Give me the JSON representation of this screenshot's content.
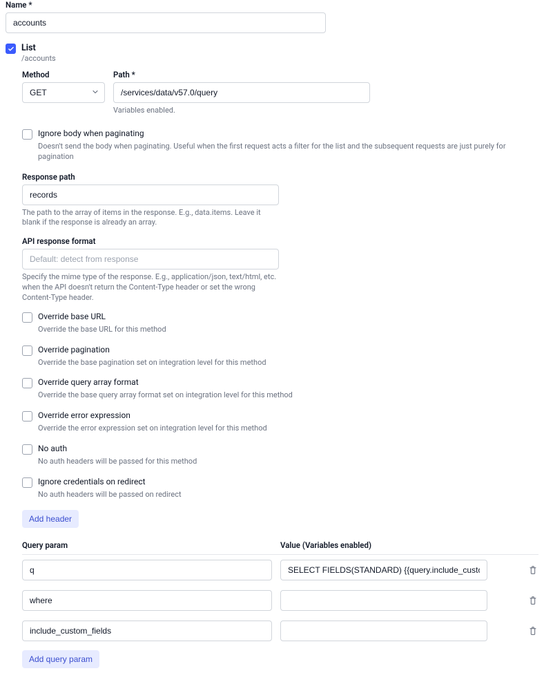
{
  "name": {
    "label": "Name *",
    "value": "accounts"
  },
  "listSection": {
    "checked": true,
    "title": "List",
    "subpath": "/accounts",
    "method": {
      "label": "Method",
      "value": "GET"
    },
    "path": {
      "label": "Path *",
      "value": "/services/data/v57.0/query",
      "hint": "Variables enabled."
    },
    "ignoreBody": {
      "label": "Ignore body when paginating",
      "hint": "Doesn't send the body when paginating. Useful when the first request acts a filter for the list and the subsequent requests are just purely for pagination"
    },
    "responsePath": {
      "label": "Response path",
      "value": "records",
      "hint": "The path to the array of items in the response. E.g., data.items. Leave it blank if the response is already an array."
    },
    "apiFormat": {
      "label": "API response format",
      "placeholder": "Default: detect from response",
      "hint": "Specify the mime type of the response. E.g., application/json, text/html, etc. when the API doesn't return the Content-Type header or set the wrong Content-Type header."
    },
    "options": [
      {
        "label": "Override base URL",
        "hint": "Override the base URL for this method"
      },
      {
        "label": "Override pagination",
        "hint": "Override the base pagination set on integration level for this method"
      },
      {
        "label": "Override query array format",
        "hint": "Override the base query array format set on integration level for this method"
      },
      {
        "label": "Override error expression",
        "hint": "Override the error expression set on integration level for this method"
      },
      {
        "label": "No auth",
        "hint": "No auth headers will be passed for this method"
      },
      {
        "label": "Ignore credentials on redirect",
        "hint": "No auth headers will be passed on redirect"
      }
    ],
    "addHeaderLabel": "Add header",
    "queryTable": {
      "headers": {
        "param": "Query param",
        "value": "Value (Variables enabled)"
      },
      "rows": [
        {
          "param": "q",
          "value": "SELECT FIELDS(STANDARD) {{query.include_custom_fields}"
        },
        {
          "param": "where",
          "value": ""
        },
        {
          "param": "include_custom_fields",
          "value": ""
        }
      ]
    },
    "addQueryParamLabel": "Add query param"
  }
}
